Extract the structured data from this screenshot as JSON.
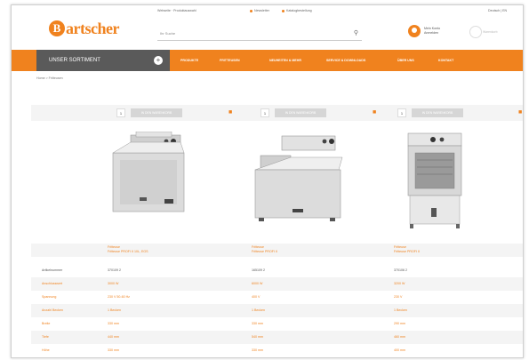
{
  "topbar": {
    "left_text": "Webseite · Produktauswahl",
    "link1": "Newsletter",
    "link2": "Katalogbestellung",
    "right_text": "Deutsch | EN"
  },
  "brand": {
    "initial": "B",
    "name": "artscher"
  },
  "search": {
    "placeholder": "Ihr Suche"
  },
  "account": {
    "line1": "Mein Konto",
    "line2": "Anmelden"
  },
  "cart": {
    "label": "Warenkorb"
  },
  "nav": {
    "sortiment": "UNSER SORTIMENT",
    "items": [
      "PRODUKTE",
      "FRITTEUSEN",
      "NEUHEITEN & MEHR",
      "SERVICE & DOWNLOADS",
      "ÜBER UNS",
      "KONTAKT"
    ]
  },
  "breadcrumb": "Home > Fritteusen",
  "compare": [
    {
      "num": "1",
      "button": "IN DEN WARENKORB"
    },
    {
      "num": "1",
      "button": "IN DEN WARENKORB"
    },
    {
      "num": "1",
      "button": "IN DEN WARENKORB"
    }
  ],
  "table": {
    "title_row": [
      {
        "line1": "Fritteuse",
        "line2": "Fritteuse PROFI II 10L, EGS"
      },
      {
        "line1": "Fritteuse",
        "line2": "Fritteuse PROFI II"
      },
      {
        "line1": "Fritteuse",
        "line2": "Fritteuse PROFI II"
      }
    ],
    "rows": [
      {
        "label": "Artikelnummer",
        "values": [
          "370109 2",
          "165109 2",
          "370106 2"
        ]
      },
      {
        "label": "Anschlusswert",
        "values": [
          "3000 W",
          "6000 W",
          "3200 W"
        ]
      },
      {
        "label": "Spannung",
        "values": [
          "230 V 50-60 Hz",
          "400 V",
          "230 V"
        ]
      },
      {
        "label": "Anzahl Becken",
        "values": [
          "1 Becken",
          "1 Becken",
          "1 Becken"
        ]
      },
      {
        "label": "Breite",
        "values": [
          "330 mm",
          "330 mm",
          "290 mm"
        ]
      },
      {
        "label": "Tiefe",
        "values": [
          "440 mm",
          "540 mm",
          "460 mm"
        ]
      },
      {
        "label": "Höhe",
        "values": [
          "330 mm",
          "330 mm",
          "400 mm"
        ]
      }
    ]
  }
}
